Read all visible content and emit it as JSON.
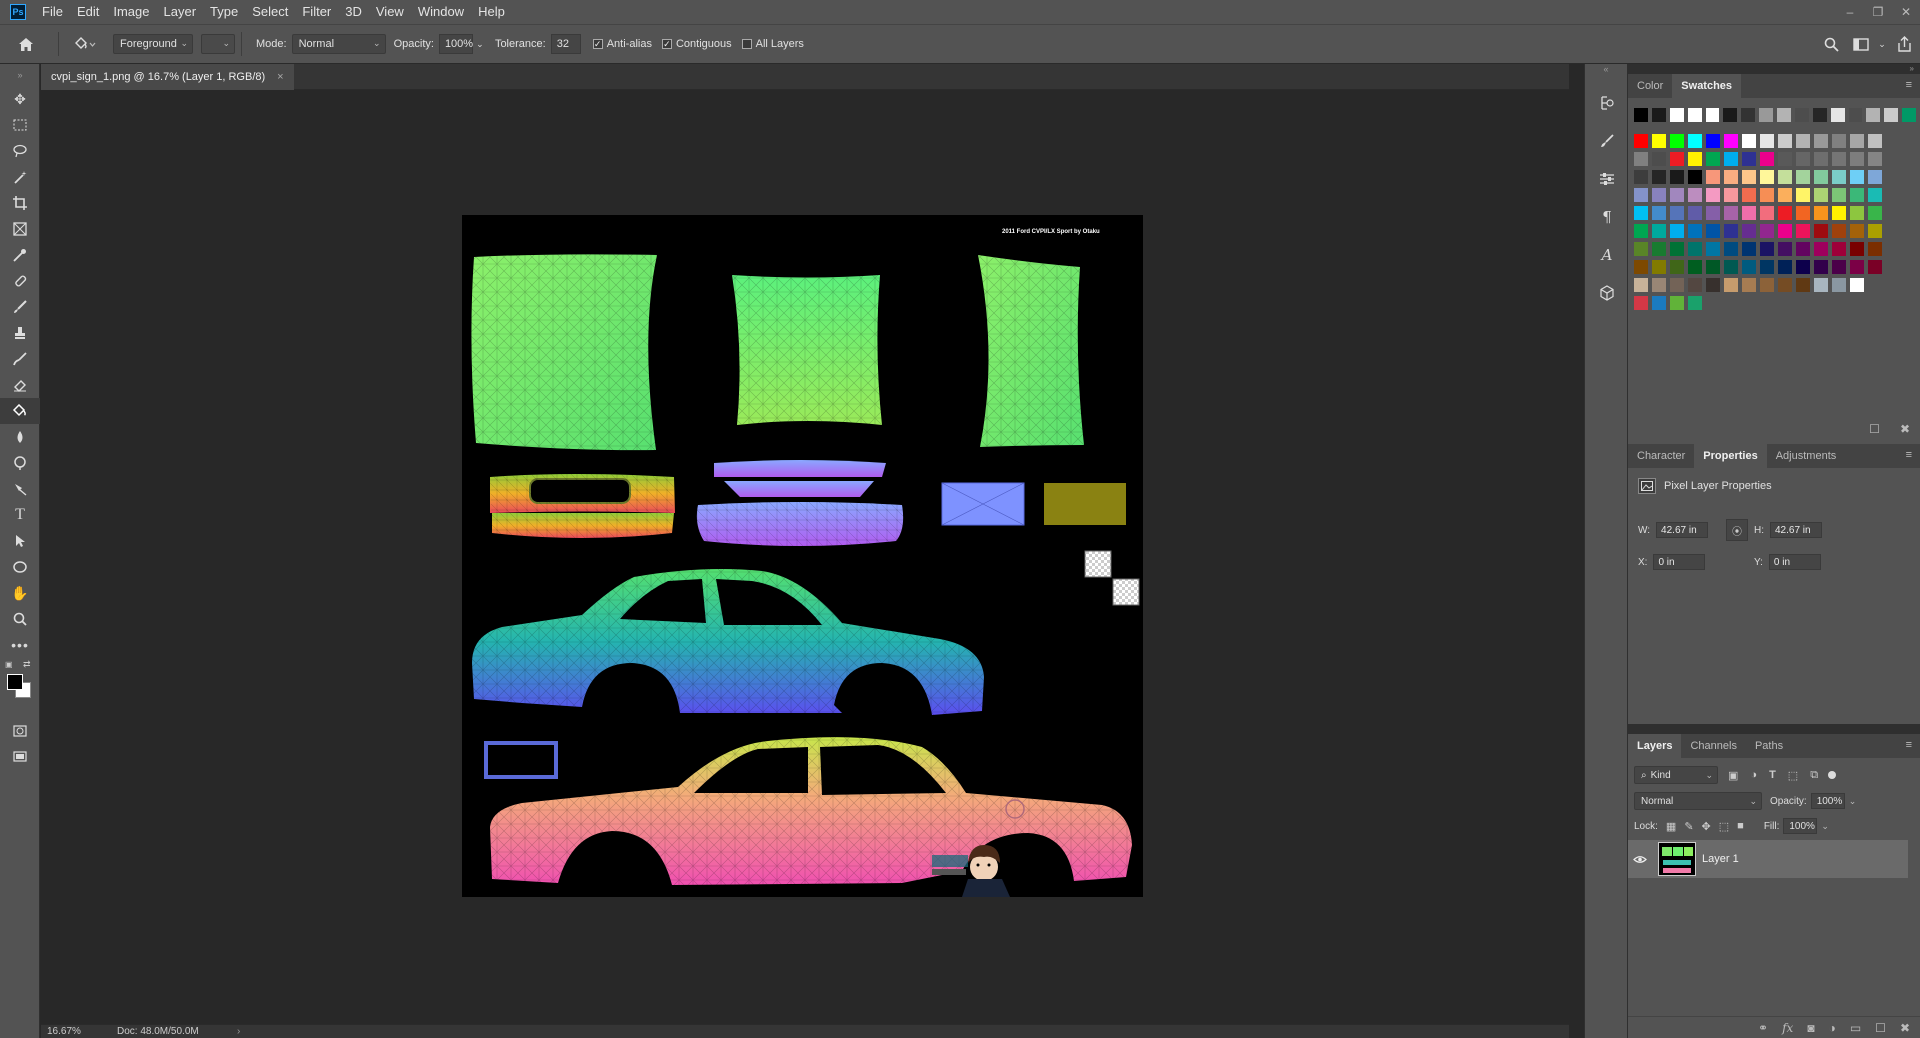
{
  "app": {
    "logo": "Ps"
  },
  "menu": [
    "File",
    "Edit",
    "Image",
    "Layer",
    "Type",
    "Select",
    "Filter",
    "3D",
    "View",
    "Window",
    "Help"
  ],
  "options": {
    "fill_source": "Foreground",
    "mode_label": "Mode:",
    "mode_value": "Normal",
    "opacity_label": "Opacity:",
    "opacity_value": "100%",
    "tolerance_label": "Tolerance:",
    "tolerance_value": "32",
    "anti_alias": {
      "label": "Anti-alias",
      "checked": true
    },
    "contiguous": {
      "label": "Contiguous",
      "checked": true
    },
    "all_layers": {
      "label": "All Layers",
      "checked": false
    }
  },
  "document": {
    "tab_title": "cvpi_sign_1.png @ 16.7% (Layer 1, RGB/8)",
    "close_glyph": "×",
    "watermark": "2011 Ford CVPI/LX Sport by Otaku",
    "zoom": "16.67%",
    "doc_size": "Doc: 48.0M/50.0M"
  },
  "color_panel": {
    "tabs": [
      "Color",
      "Swatches"
    ],
    "active": "Swatches"
  },
  "swatches": {
    "rows": [
      [
        "#000000",
        "#1a1a1a",
        "#ffffff",
        "#ffffff",
        "#ffffff",
        "#1a1a1a",
        "#333333",
        "#999999",
        "#b3b3b3",
        "#4d4d4d",
        "#262626",
        "#e6e6e6",
        "#4d4d4d",
        "#b3b3b3",
        "#cccccc",
        "#009966"
      ],
      [
        "#ff0000",
        "#ffff00",
        "#00ff00",
        "#00ffff",
        "#0000ff",
        "#ff00ff",
        "#ffffff",
        "#e6e6e6",
        "#cccccc",
        "#b3b3b3",
        "#999999",
        "#808080",
        "#a6a6a6",
        "#c0c0c0"
      ],
      [
        "#808080",
        "#4d4d4d",
        "#ed1c24",
        "#fff200",
        "#00a651",
        "#00aeef",
        "#2e3192",
        "#ec008c",
        "#595959",
        "#666666",
        "#6e6e6e",
        "#757575",
        "#7d7d7d",
        "#858585"
      ],
      [
        "#3d3d3d",
        "#262626",
        "#1a1a1a",
        "#000000",
        "#f7977a",
        "#f9ad81",
        "#fdc68a",
        "#fff79a",
        "#c4df9b",
        "#a3d39c",
        "#82ca9d",
        "#7bcdc8",
        "#6ecff6",
        "#7ea7d8"
      ],
      [
        "#8493ca",
        "#8882be",
        "#a187be",
        "#bc8dbf",
        "#f49ac2",
        "#f6989d",
        "#f26c4f",
        "#f68e55",
        "#fbaf5c",
        "#fff467",
        "#acd373",
        "#7cc576",
        "#3bb878",
        "#1abbb4"
      ],
      [
        "#00bff3",
        "#438ccb",
        "#5574b9",
        "#605ca8",
        "#855fa8",
        "#a763a8",
        "#f06eaa",
        "#f26d7d",
        "#ed1c24",
        "#f26522",
        "#f7941d",
        "#fff200",
        "#8dc63f",
        "#39b54a"
      ],
      [
        "#00a651",
        "#00a99d",
        "#00aeef",
        "#0072bc",
        "#0054a6",
        "#2e3192",
        "#662d91",
        "#92278f",
        "#ec008c",
        "#ed145b",
        "#9e0b0f",
        "#a0410d",
        "#a36209",
        "#aba000"
      ],
      [
        "#598527",
        "#197b30",
        "#007236",
        "#00746b",
        "#0076a3",
        "#004b80",
        "#003471",
        "#1b1464",
        "#440e62",
        "#630460",
        "#9e005d",
        "#9e0039",
        "#790000",
        "#7b2e00"
      ],
      [
        "#7d4900",
        "#827b00",
        "#406618",
        "#005e20",
        "#005826",
        "#005952",
        "#005b7f",
        "#003663",
        "#002157",
        "#0d004c",
        "#32004b",
        "#4b0049",
        "#7b0046",
        "#7a0026"
      ],
      [
        "#c7b299",
        "#998675",
        "#736357",
        "#534741",
        "#37302d",
        "#c69c6d",
        "#a67c52",
        "#8c6239",
        "#754c24",
        "#603913",
        "#a8b5bf",
        "#8a97a1",
        "#ffffff"
      ],
      [
        "#d43846",
        "#1b7bbf",
        "#61b339",
        "#1aa16b"
      ]
    ]
  },
  "properties_panel": {
    "tabs": [
      "Character",
      "Properties",
      "Adjustments"
    ],
    "active": "Properties",
    "title": "Pixel Layer Properties",
    "w_label": "W:",
    "w_value": "42.67 in",
    "h_label": "H:",
    "h_value": "42.67 in",
    "x_label": "X:",
    "x_value": "0 in",
    "y_label": "Y:",
    "y_value": "0 in"
  },
  "layers_panel": {
    "tabs": [
      "Layers",
      "Channels",
      "Paths"
    ],
    "active": "Layers",
    "filter_kind": "Kind",
    "blend_mode": "Normal",
    "opacity_label": "Opacity:",
    "opacity_value": "100%",
    "lock_label": "Lock:",
    "fill_label": "Fill:",
    "fill_value": "100%",
    "layers": [
      {
        "name": "Layer 1",
        "visible": true,
        "selected": true
      }
    ]
  },
  "icons": {
    "home": "home-icon",
    "bucket": "paint-bucket-icon",
    "search": "search-icon",
    "workspace": "workspace-icon",
    "share": "share-icon"
  }
}
